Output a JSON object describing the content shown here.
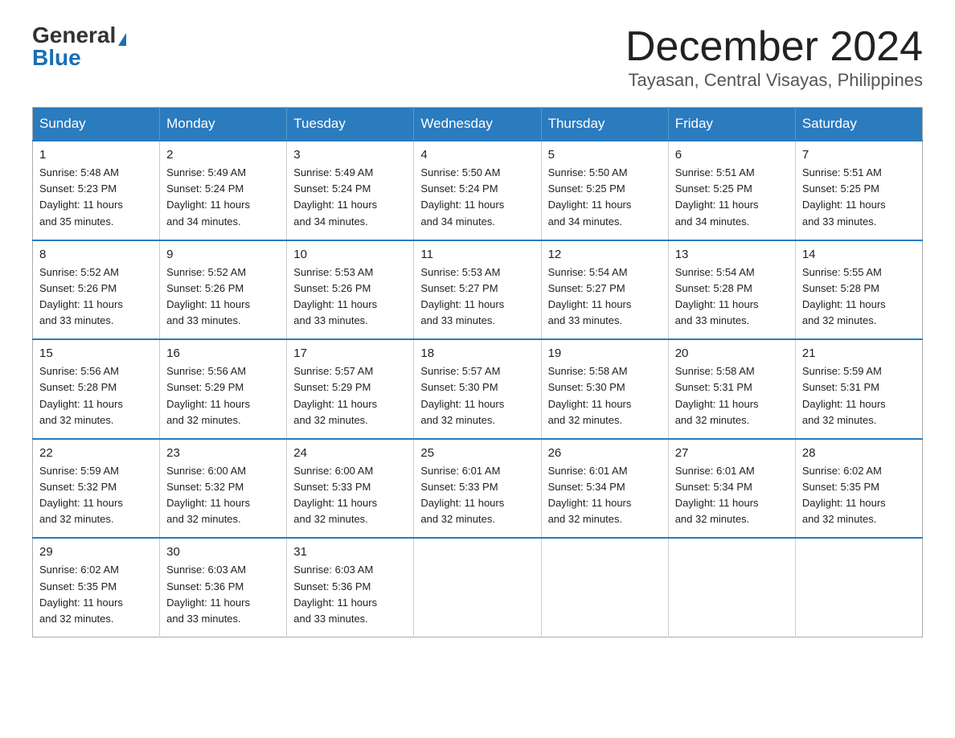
{
  "header": {
    "logo_general": "General",
    "logo_blue": "Blue",
    "month_title": "December 2024",
    "location": "Tayasan, Central Visayas, Philippines"
  },
  "weekdays": [
    "Sunday",
    "Monday",
    "Tuesday",
    "Wednesday",
    "Thursday",
    "Friday",
    "Saturday"
  ],
  "weeks": [
    [
      {
        "day": "1",
        "sunrise": "5:48 AM",
        "sunset": "5:23 PM",
        "daylight": "11 hours and 35 minutes."
      },
      {
        "day": "2",
        "sunrise": "5:49 AM",
        "sunset": "5:24 PM",
        "daylight": "11 hours and 34 minutes."
      },
      {
        "day": "3",
        "sunrise": "5:49 AM",
        "sunset": "5:24 PM",
        "daylight": "11 hours and 34 minutes."
      },
      {
        "day": "4",
        "sunrise": "5:50 AM",
        "sunset": "5:24 PM",
        "daylight": "11 hours and 34 minutes."
      },
      {
        "day": "5",
        "sunrise": "5:50 AM",
        "sunset": "5:25 PM",
        "daylight": "11 hours and 34 minutes."
      },
      {
        "day": "6",
        "sunrise": "5:51 AM",
        "sunset": "5:25 PM",
        "daylight": "11 hours and 34 minutes."
      },
      {
        "day": "7",
        "sunrise": "5:51 AM",
        "sunset": "5:25 PM",
        "daylight": "11 hours and 33 minutes."
      }
    ],
    [
      {
        "day": "8",
        "sunrise": "5:52 AM",
        "sunset": "5:26 PM",
        "daylight": "11 hours and 33 minutes."
      },
      {
        "day": "9",
        "sunrise": "5:52 AM",
        "sunset": "5:26 PM",
        "daylight": "11 hours and 33 minutes."
      },
      {
        "day": "10",
        "sunrise": "5:53 AM",
        "sunset": "5:26 PM",
        "daylight": "11 hours and 33 minutes."
      },
      {
        "day": "11",
        "sunrise": "5:53 AM",
        "sunset": "5:27 PM",
        "daylight": "11 hours and 33 minutes."
      },
      {
        "day": "12",
        "sunrise": "5:54 AM",
        "sunset": "5:27 PM",
        "daylight": "11 hours and 33 minutes."
      },
      {
        "day": "13",
        "sunrise": "5:54 AM",
        "sunset": "5:28 PM",
        "daylight": "11 hours and 33 minutes."
      },
      {
        "day": "14",
        "sunrise": "5:55 AM",
        "sunset": "5:28 PM",
        "daylight": "11 hours and 32 minutes."
      }
    ],
    [
      {
        "day": "15",
        "sunrise": "5:56 AM",
        "sunset": "5:28 PM",
        "daylight": "11 hours and 32 minutes."
      },
      {
        "day": "16",
        "sunrise": "5:56 AM",
        "sunset": "5:29 PM",
        "daylight": "11 hours and 32 minutes."
      },
      {
        "day": "17",
        "sunrise": "5:57 AM",
        "sunset": "5:29 PM",
        "daylight": "11 hours and 32 minutes."
      },
      {
        "day": "18",
        "sunrise": "5:57 AM",
        "sunset": "5:30 PM",
        "daylight": "11 hours and 32 minutes."
      },
      {
        "day": "19",
        "sunrise": "5:58 AM",
        "sunset": "5:30 PM",
        "daylight": "11 hours and 32 minutes."
      },
      {
        "day": "20",
        "sunrise": "5:58 AM",
        "sunset": "5:31 PM",
        "daylight": "11 hours and 32 minutes."
      },
      {
        "day": "21",
        "sunrise": "5:59 AM",
        "sunset": "5:31 PM",
        "daylight": "11 hours and 32 minutes."
      }
    ],
    [
      {
        "day": "22",
        "sunrise": "5:59 AM",
        "sunset": "5:32 PM",
        "daylight": "11 hours and 32 minutes."
      },
      {
        "day": "23",
        "sunrise": "6:00 AM",
        "sunset": "5:32 PM",
        "daylight": "11 hours and 32 minutes."
      },
      {
        "day": "24",
        "sunrise": "6:00 AM",
        "sunset": "5:33 PM",
        "daylight": "11 hours and 32 minutes."
      },
      {
        "day": "25",
        "sunrise": "6:01 AM",
        "sunset": "5:33 PM",
        "daylight": "11 hours and 32 minutes."
      },
      {
        "day": "26",
        "sunrise": "6:01 AM",
        "sunset": "5:34 PM",
        "daylight": "11 hours and 32 minutes."
      },
      {
        "day": "27",
        "sunrise": "6:01 AM",
        "sunset": "5:34 PM",
        "daylight": "11 hours and 32 minutes."
      },
      {
        "day": "28",
        "sunrise": "6:02 AM",
        "sunset": "5:35 PM",
        "daylight": "11 hours and 32 minutes."
      }
    ],
    [
      {
        "day": "29",
        "sunrise": "6:02 AM",
        "sunset": "5:35 PM",
        "daylight": "11 hours and 32 minutes."
      },
      {
        "day": "30",
        "sunrise": "6:03 AM",
        "sunset": "5:36 PM",
        "daylight": "11 hours and 33 minutes."
      },
      {
        "day": "31",
        "sunrise": "6:03 AM",
        "sunset": "5:36 PM",
        "daylight": "11 hours and 33 minutes."
      },
      null,
      null,
      null,
      null
    ]
  ]
}
